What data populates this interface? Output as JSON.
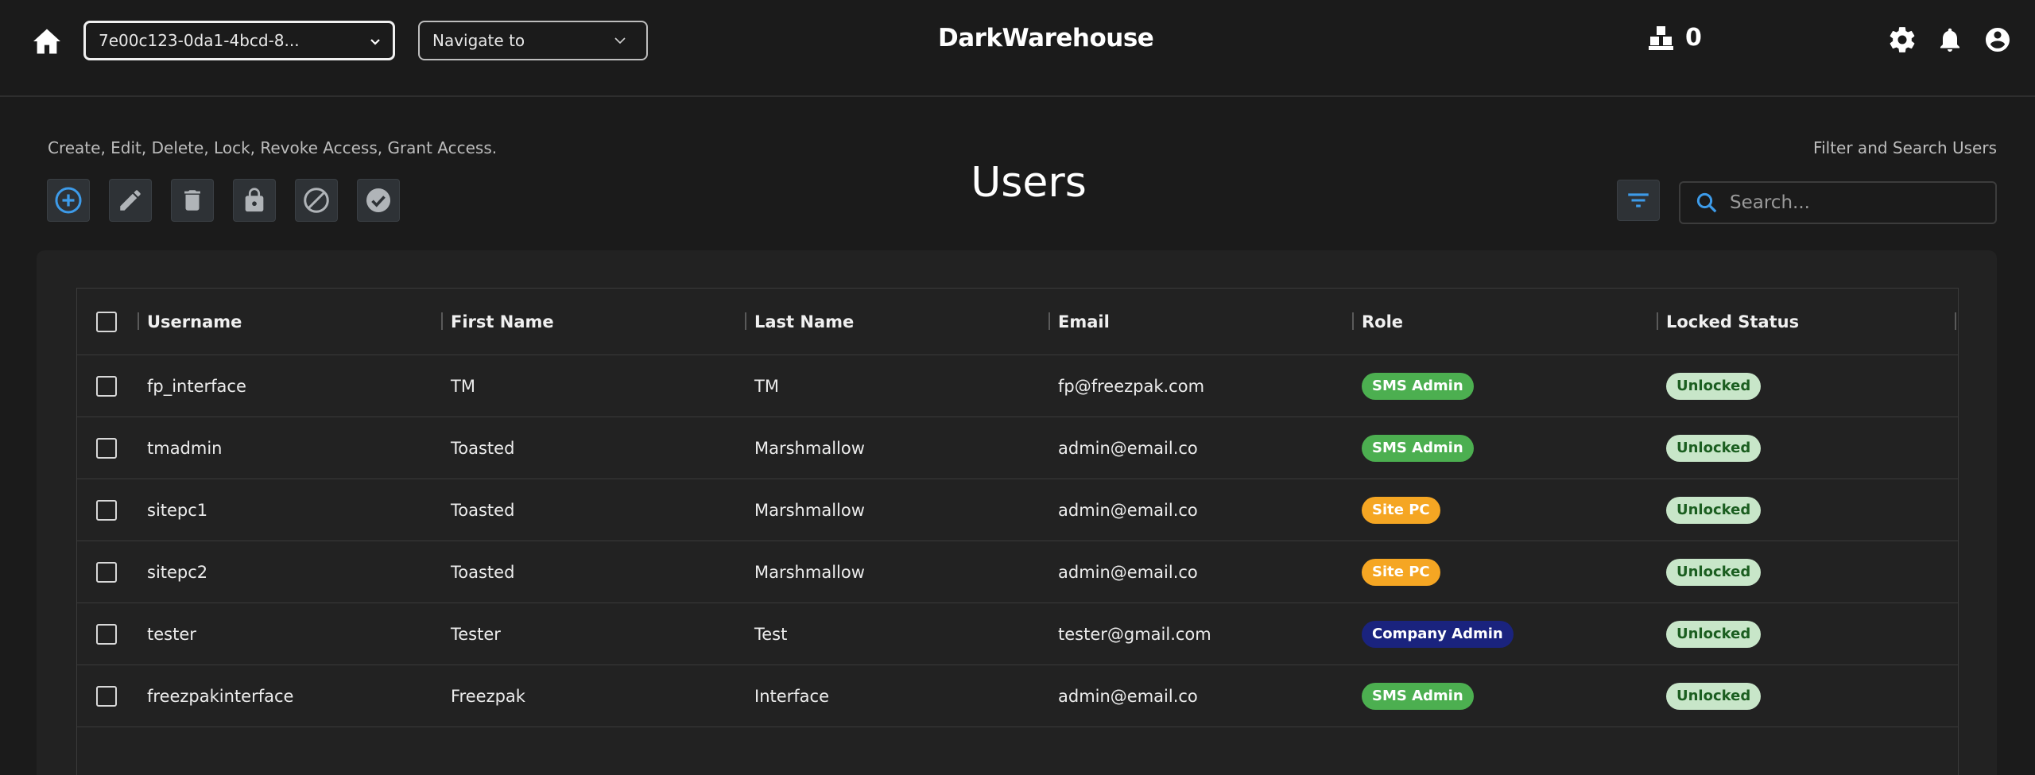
{
  "header": {
    "brand": "DarkWarehouse",
    "warehouse_value": "7e00c123-0da1-4bcd-8...",
    "nav_placeholder": "Navigate to",
    "pallet_count": "0"
  },
  "toolbar": {
    "actions_caption": "Create, Edit, Delete, Lock, Revoke Access, Grant Access.",
    "filter_caption": "Filter and Search Users",
    "title": "Users",
    "search_placeholder": "Search..."
  },
  "table": {
    "columns": [
      "Username",
      "First Name",
      "Last Name",
      "Email",
      "Role",
      "Locked Status"
    ],
    "rows": [
      {
        "username": "fp_interface",
        "first": "TM",
        "last": "TM",
        "email": "fp@freezpak.com",
        "role": "SMS Admin",
        "lock": "Unlocked"
      },
      {
        "username": "tmadmin",
        "first": "Toasted",
        "last": "Marshmallow",
        "email": "admin@email.co",
        "role": "SMS Admin",
        "lock": "Unlocked"
      },
      {
        "username": "sitepc1",
        "first": "Toasted",
        "last": "Marshmallow",
        "email": "admin@email.co",
        "role": "Site PC",
        "lock": "Unlocked"
      },
      {
        "username": "sitepc2",
        "first": "Toasted",
        "last": "Marshmallow",
        "email": "admin@email.co",
        "role": "Site PC",
        "lock": "Unlocked"
      },
      {
        "username": "tester",
        "first": "Tester",
        "last": "Test",
        "email": "tester@gmail.com",
        "role": "Company Admin",
        "lock": "Unlocked"
      },
      {
        "username": "freezpakinterface",
        "first": "Freezpak",
        "last": "Interface",
        "email": "admin@email.co",
        "role": "SMS Admin",
        "lock": "Unlocked"
      }
    ]
  },
  "colors": {
    "accent_blue": "#3d9be9",
    "icon_grey": "#b0b4b8",
    "sms_admin": "#4caf50",
    "site_pc": "#f5a623",
    "company_admin": "#1a237e",
    "unlocked_bg": "#c8e6c9",
    "unlocked_text": "#1b5e20"
  }
}
